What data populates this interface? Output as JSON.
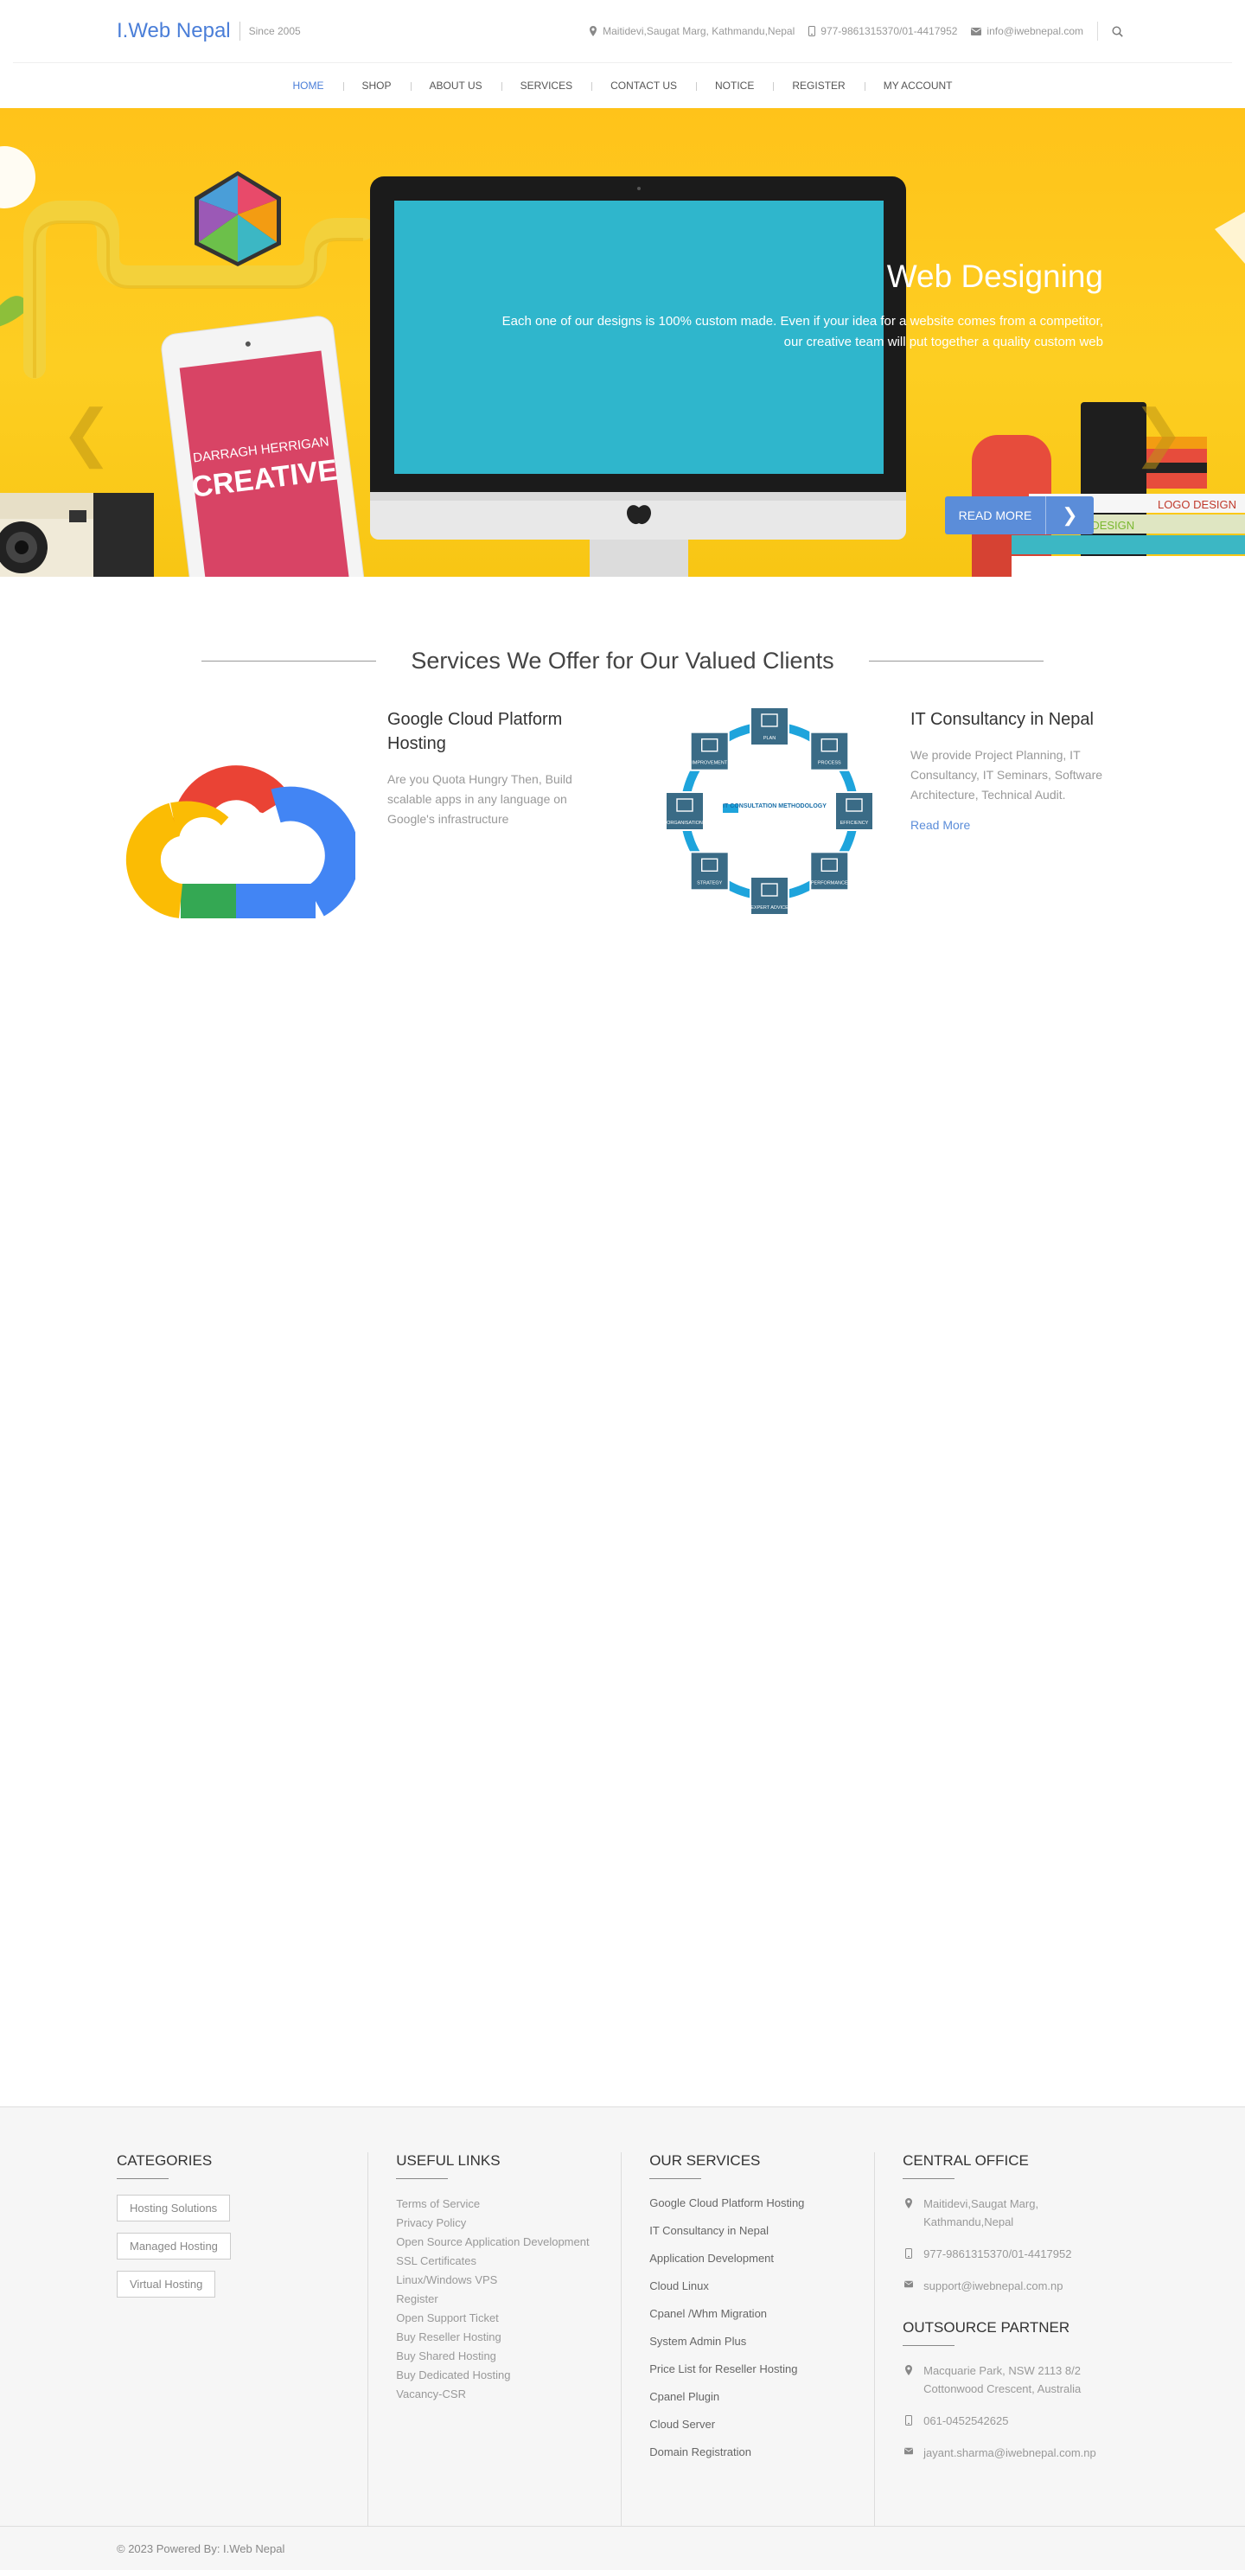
{
  "header": {
    "logo": "I.Web Nepal",
    "since": "Since 2005",
    "address": "Maitidevi,Saugat Marg, Kathmandu,Nepal",
    "phone": "977-9861315370/01-4417952",
    "email": "info@iwebnepal.com"
  },
  "nav": [
    "HOME",
    "SHOP",
    "ABOUT US",
    "SERVICES",
    "CONTACT US",
    "NOTICE",
    "REGISTER",
    "MY ACCOUNT"
  ],
  "hero": {
    "title": "Web Designing",
    "text": "Each one of our designs is 100% custom made. Even if your idea for a website comes from a competitor, our creative team will put together a quality custom web",
    "button": "READ MORE",
    "button_arrow": "❯",
    "prev": "❮",
    "next": "❯",
    "tablet_text1": "DARRAGH HERRIGAN",
    "tablet_text2": "CREATIVE",
    "book_label1": "LOGO DESIGN",
    "book_label2": "DISPLAY DESIGN",
    "slides": 3,
    "active_slide": 0
  },
  "services": {
    "heading": "Services We Offer for Our Valued Clients",
    "cards": [
      {
        "title": "Google Cloud Platform Hosting",
        "text": "Are you Quota Hungry Then, Build scalable apps in any language on Google's infrastructure"
      },
      {
        "title": "IT Consultancy in Nepal",
        "text": "We provide Project Planning, IT Consultancy, IT Seminars, Software Architecture, Technical Audit.",
        "link": "Read More",
        "diagram_center": "IT CONSULTATION METHODOLOGY",
        "diagram_nodes": [
          "PLAN",
          "PROCESS",
          "EFFICIENCY",
          "PERFORMANCE",
          "EXPERT ADVICE",
          "STRATEGY",
          "ORGANISATION",
          "IMPROVEMENT"
        ]
      }
    ]
  },
  "footer": {
    "categories": {
      "title": "CATEGORIES",
      "items": [
        "Hosting Solutions",
        "Managed Hosting",
        "Virtual Hosting"
      ]
    },
    "useful": {
      "title": "USEFUL LINKS",
      "items": [
        "Terms of Service",
        "Privacy Policy",
        "Open Source Application Development",
        "SSL Certificates",
        "Linux/Windows VPS",
        "Register",
        "Open Support Ticket",
        "Buy Reseller Hosting",
        "Buy Shared Hosting",
        "Buy Dedicated Hosting",
        "Vacancy-CSR"
      ]
    },
    "services": {
      "title": "OUR SERVICES",
      "items": [
        "Google Cloud Platform Hosting",
        "IT Consultancy in Nepal",
        "Application Development",
        "Cloud Linux",
        "Cpanel /Whm Migration",
        "System Admin Plus",
        "Price List for Reseller Hosting",
        "Cpanel Plugin",
        "Cloud Server",
        "Domain Registration"
      ]
    },
    "office": {
      "title": "CENTRAL OFFICE",
      "address": "Maitidevi,Saugat Marg, Kathmandu,Nepal",
      "phone": "977-9861315370/01-4417952",
      "email": "support@iwebnepal.com.np"
    },
    "partner": {
      "title": "OUTSOURCE PARTNER",
      "address": "Macquarie Park, NSW 2113 8/2 Cottonwood Crescent, Australia",
      "phone": "061-0452542625",
      "email": "jayant.sharma@iwebnepal.com.np"
    },
    "copyright": "© 2023 Powered By: I.Web Nepal"
  }
}
